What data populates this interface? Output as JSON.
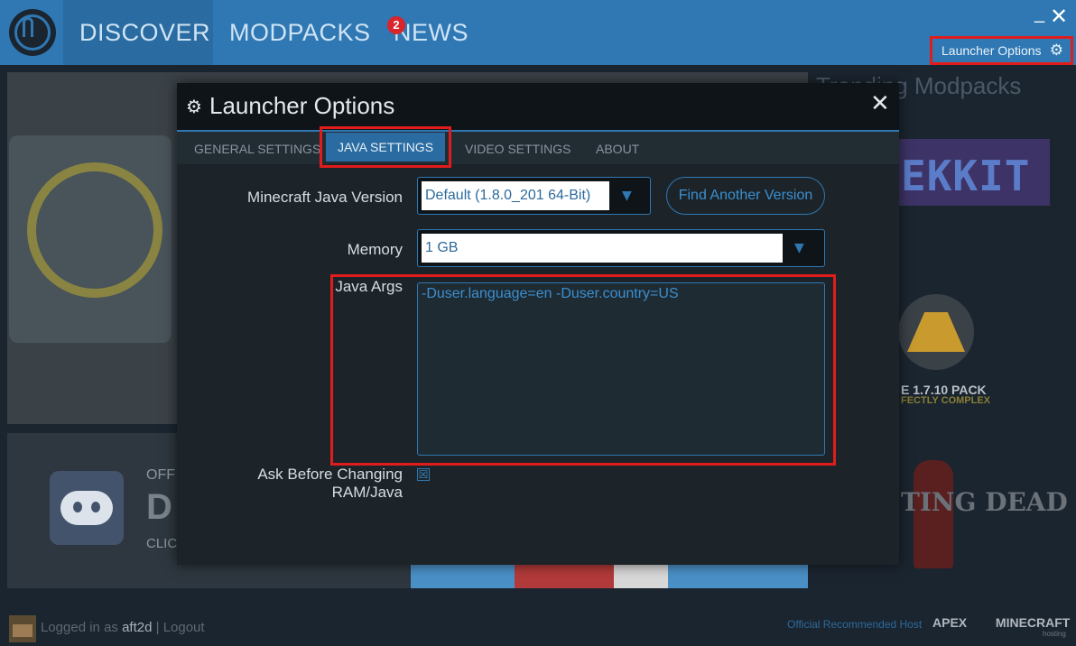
{
  "topnav": {
    "tabs": [
      "DISCOVER",
      "MODPACKS",
      "NEWS"
    ],
    "news_badge": "2",
    "minimize_glyph": "_",
    "close_glyph": "✕",
    "launcher_options_label": "Launcher Options",
    "gear_glyph": "⚙"
  },
  "background": {
    "trending_title": "Trending Modpacks",
    "tekkit_text": "EKKIT",
    "pack_title": "E 1.7.10 PACK",
    "pack_sub": "FECTLY COMPLEX",
    "discord_off": "OFF",
    "discord_big": "D",
    "discord_click": "CLIC",
    "walking_dead": "TING DEAD"
  },
  "footer": {
    "logged_in_prefix": "Logged in as ",
    "username": "aft2d",
    "separator": " | ",
    "logout": "Logout",
    "host_text": "Official Recommended Host",
    "apex_left": "APEX",
    "apex_right": "MINECRAFT",
    "apex_hosting": "hosting"
  },
  "modal": {
    "title": "Launcher Options",
    "gear_glyph": "⚙",
    "close_glyph": "✕",
    "tabs": {
      "general": "GENERAL SETTINGS",
      "java": "JAVA SETTINGS",
      "video": "VIDEO SETTINGS",
      "about": "ABOUT"
    },
    "java_version": {
      "label": "Minecraft Java Version",
      "value": "Default (1.8.0_201 64-Bit)",
      "arrow": "▼"
    },
    "find_another_label": "Find Another Version",
    "memory": {
      "label": "Memory",
      "value": "1 GB",
      "arrow": "▼"
    },
    "java_args": {
      "label": "Java Args",
      "value": "-Duser.language=en -Duser.country=US"
    },
    "ask_before": {
      "label": "Ask Before Changing RAM/Java",
      "checked_glyph": "☒"
    }
  },
  "colors": {
    "topbar": "#2f78b3",
    "accent": "#2f78b3",
    "highlight": "#e01c1c",
    "modal_bg": "#1c2429"
  }
}
